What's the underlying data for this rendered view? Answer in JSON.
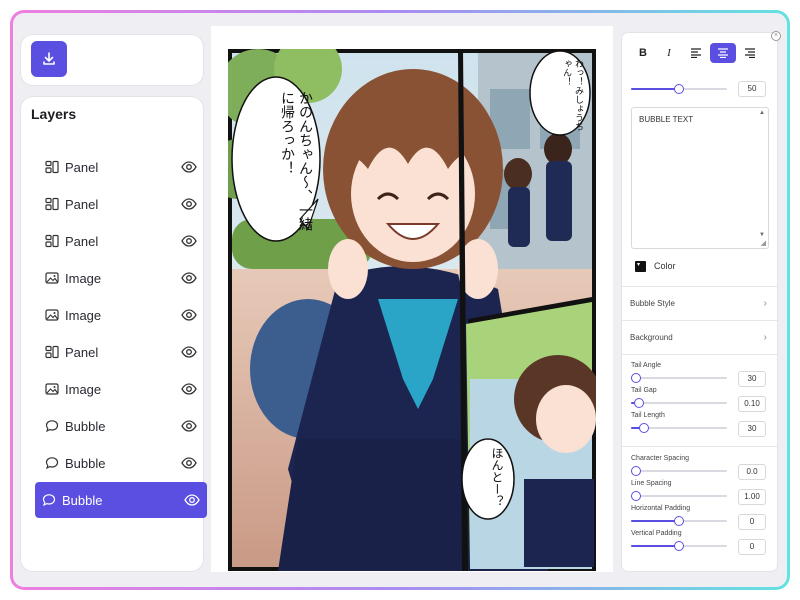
{
  "layers": {
    "title": "Layers",
    "items": [
      {
        "label": "Panel",
        "icon": "panel-icon"
      },
      {
        "label": "Panel",
        "icon": "panel-icon"
      },
      {
        "label": "Panel",
        "icon": "panel-icon"
      },
      {
        "label": "Image",
        "icon": "image-icon"
      },
      {
        "label": "Image",
        "icon": "image-icon"
      },
      {
        "label": "Panel",
        "icon": "panel-icon"
      },
      {
        "label": "Image",
        "icon": "image-icon"
      },
      {
        "label": "Bubble",
        "icon": "bubble-icon"
      },
      {
        "label": "Bubble",
        "icon": "bubble-icon"
      },
      {
        "label": "Bubble",
        "icon": "bubble-icon",
        "selected": true
      }
    ]
  },
  "comic": {
    "bubble1": "かのんちゃん〜、一緒に帰ろっか！",
    "bubble2": "わっ！みしょうちゃん！",
    "bubble3": "ほんとー？"
  },
  "props": {
    "bold_label": "B",
    "italic_label": "I",
    "font_size": {
      "value": "50",
      "fraction": 0.5
    },
    "bubble_text": "BUBBLE TEXT",
    "color_label": "Color",
    "bubble_style_label": "Bubble Style",
    "background_label": "Background",
    "tail_angle": {
      "label": "Tail Angle",
      "value": "30",
      "fraction": 0.05
    },
    "tail_gap": {
      "label": "Tail Gap",
      "value": "0.10",
      "fraction": 0.08
    },
    "tail_length": {
      "label": "Tail Length",
      "value": "30",
      "fraction": 0.14
    },
    "character_spacing": {
      "label": "Character Spacing",
      "value": "0.0",
      "fraction": 0.0
    },
    "line_spacing": {
      "label": "Line Spacing",
      "value": "1.00",
      "fraction": 0.0
    },
    "horizontal_padding": {
      "label": "Horizontal Padding",
      "value": "0",
      "fraction": 0.5
    },
    "vertical_padding": {
      "label": "Vertical Padding",
      "value": "0",
      "fraction": 0.5
    }
  },
  "colors": {
    "accent": "#5a4fe0",
    "frame_left": "#ee7fe0",
    "frame_right": "#62e3e0"
  }
}
